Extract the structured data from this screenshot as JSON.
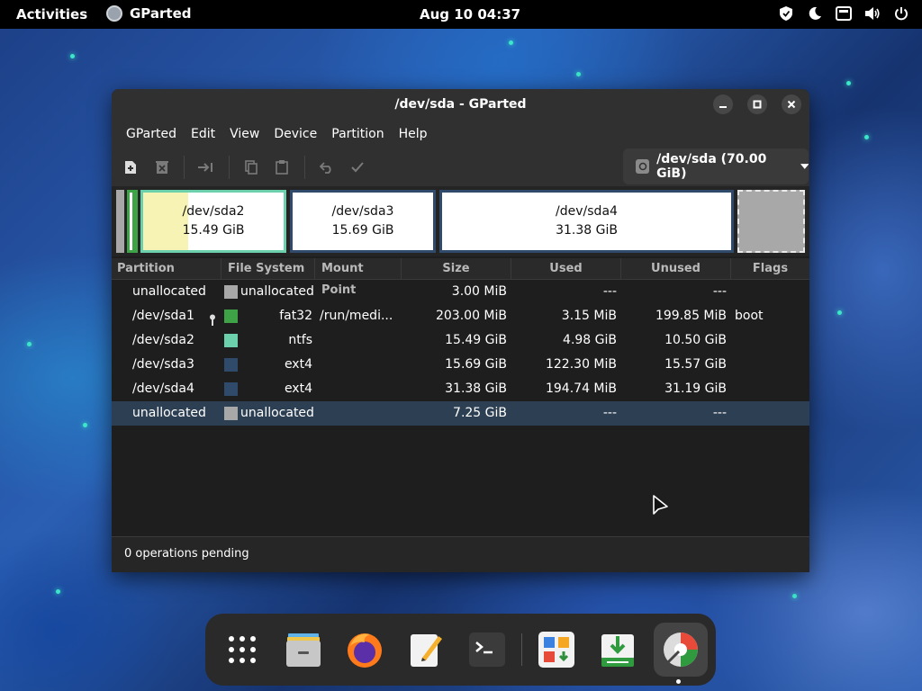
{
  "topbar": {
    "activities": "Activities",
    "app_name": "GParted",
    "clock": "Aug 10  04:37"
  },
  "window": {
    "title": "/dev/sda - GParted",
    "menu": [
      "GParted",
      "Edit",
      "View",
      "Device",
      "Partition",
      "Help"
    ],
    "device_selector": "/dev/sda (70.00 GiB)",
    "graph": [
      {
        "name": "/dev/sda2",
        "size": "15.49 GiB",
        "used_fraction": 0.32
      },
      {
        "name": "/dev/sda3",
        "size": "15.69 GiB",
        "used_fraction": 0.01
      },
      {
        "name": "/dev/sda4",
        "size": "31.38 GiB",
        "used_fraction": 0.01
      }
    ],
    "columns": [
      "Partition",
      "File System",
      "Mount Point",
      "Size",
      "Used",
      "Unused",
      "Flags"
    ],
    "rows": [
      {
        "partition": "unallocated",
        "fs": "unallocated",
        "mount": "",
        "size": "3.00 MiB",
        "used": "---",
        "unused": "---",
        "flags": "",
        "color": "#a8a8a8"
      },
      {
        "partition": "/dev/sda1",
        "fs": "fat32",
        "mount": "/run/medi...",
        "size": "203.00 MiB",
        "used": "3.15 MiB",
        "unused": "199.85 MiB",
        "flags": "boot",
        "color": "#3ea346"
      },
      {
        "partition": "/dev/sda2",
        "fs": "ntfs",
        "mount": "",
        "size": "15.49 GiB",
        "used": "4.98 GiB",
        "unused": "10.50 GiB",
        "flags": "",
        "color": "#6cd0ac"
      },
      {
        "partition": "/dev/sda3",
        "fs": "ext4",
        "mount": "",
        "size": "15.69 GiB",
        "used": "122.30 MiB",
        "unused": "15.57 GiB",
        "flags": "",
        "color": "#2f4a6b"
      },
      {
        "partition": "/dev/sda4",
        "fs": "ext4",
        "mount": "",
        "size": "31.38 GiB",
        "used": "194.74 MiB",
        "unused": "31.19 GiB",
        "flags": "",
        "color": "#2f4a6b"
      },
      {
        "partition": "unallocated",
        "fs": "unallocated",
        "mount": "",
        "size": "7.25 GiB",
        "used": "---",
        "unused": "---",
        "flags": "",
        "color": "#a8a8a8"
      }
    ],
    "status": "0 operations pending"
  },
  "colors": {
    "ntfs": "#6cd0ac",
    "fat32": "#3ea346",
    "ext4": "#2f4a6b",
    "unallocated": "#a8a8a8",
    "used_fill": "#f6f3b4",
    "selected_row": "#2d3f53"
  },
  "dock": [
    "app-grid-icon",
    "files-icon",
    "firefox-icon",
    "text-editor-icon",
    "terminal-icon",
    "software-icon",
    "installer-icon",
    "gparted-icon"
  ]
}
